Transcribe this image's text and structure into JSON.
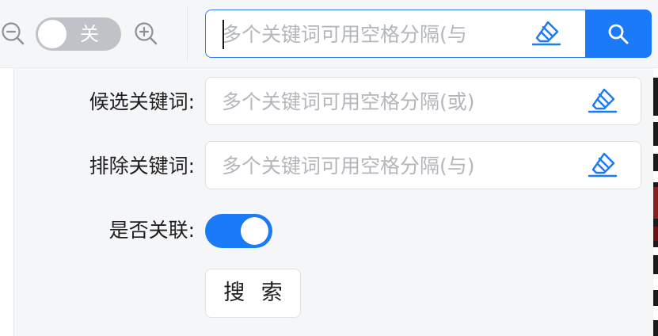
{
  "toolbar": {
    "zoom_out_icon": "zoom-out-icon",
    "zoom_in_icon": "zoom-in-icon",
    "view_toggle_label": "关",
    "search_placeholder": "多个关键词可用空格分隔(与",
    "clear_icon": "eraser-icon",
    "search_icon": "search-icon"
  },
  "advanced": {
    "candidate": {
      "label": "候选关键词:",
      "placeholder": "多个关键词可用空格分隔(或)"
    },
    "exclude": {
      "label": "排除关键词:",
      "placeholder": "多个关键词可用空格分隔(与)"
    },
    "relate": {
      "label": "是否关联:",
      "enabled": true
    },
    "submit_label": "搜 索"
  },
  "colors": {
    "accent": "#1a7af8",
    "toggle_off": "#bfc2c7",
    "panel_bg": "#f5f6f8"
  }
}
